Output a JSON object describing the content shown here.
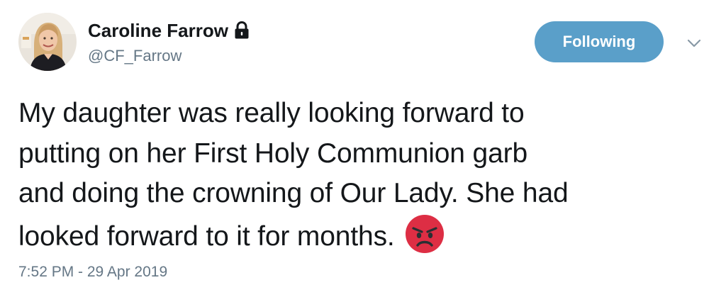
{
  "author": {
    "display_name": "Caroline Farrow",
    "handle": "@CF_Farrow",
    "protected_icon": "lock-icon",
    "avatar_icon": "profile-photo"
  },
  "actions": {
    "follow_label": "Following",
    "menu_icon": "chevron-down-icon"
  },
  "tweet": {
    "lines": [
      "My daughter was really looking forward to",
      "putting on her First Holy Communion garb",
      "and doing the crowning of Our Lady. She had",
      "looked forward to it for months."
    ],
    "emoji_icon": "angry-face-icon",
    "timestamp": "7:52 PM - 29 Apr 2019"
  },
  "colors": {
    "button_bg": "#5a9fc9",
    "secondary_text": "#657786",
    "primary_text": "#14171a",
    "emoji_red": "#dd2e44"
  }
}
